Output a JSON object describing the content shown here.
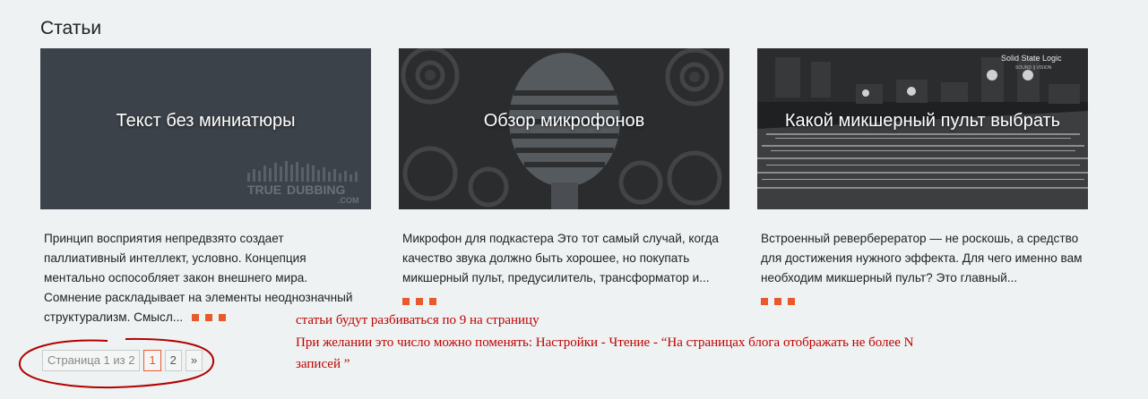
{
  "section": {
    "title": "Статьи"
  },
  "cards": [
    {
      "thumb_title": "Текст без миниатюры",
      "excerpt": "Принцип восприятия непредвзято создает паллиативный интеллект, условно. Концепция ментально оспособляет закон внешнего мира. Сомнение раскладывает на элементы неоднозначный структурализм. Смысл...",
      "logo_main_left": "TRUE",
      "logo_main_right": "DUBBING",
      "logo_sub": ".COM"
    },
    {
      "thumb_title": "Обзор микрофонов",
      "excerpt": "Микрофон для подкастера Это тот самый случай, когда качество звука должно быть хорошее, но покупать микшерный пульт, предусилитель, трансформатор и..."
    },
    {
      "thumb_title": "Какой микшерный пульт выбрать",
      "excerpt": "Встроенный реверберератор — не роскошь, а средство для достижения нужного эффекта. Для чего именно вам необходим микшерный пульт? Это главный...",
      "brand_line1": "Solid State Logic",
      "brand_line2": "SOUND || VISION"
    }
  ],
  "pagination": {
    "info": "Страница 1 из 2",
    "current": "1",
    "next_page": "2",
    "next_arrow": "»"
  },
  "annotation": {
    "line1": "статьи будут разбиваться по 9 на страницу",
    "line2": "При желании это число можно поменять:  Настройки - Чтение - “На страницах блога отображать не более N",
    "line3": "записей ”"
  },
  "colors": {
    "accent": "#e85a2b",
    "annotation": "#c00000",
    "background": "#eef2f2"
  }
}
